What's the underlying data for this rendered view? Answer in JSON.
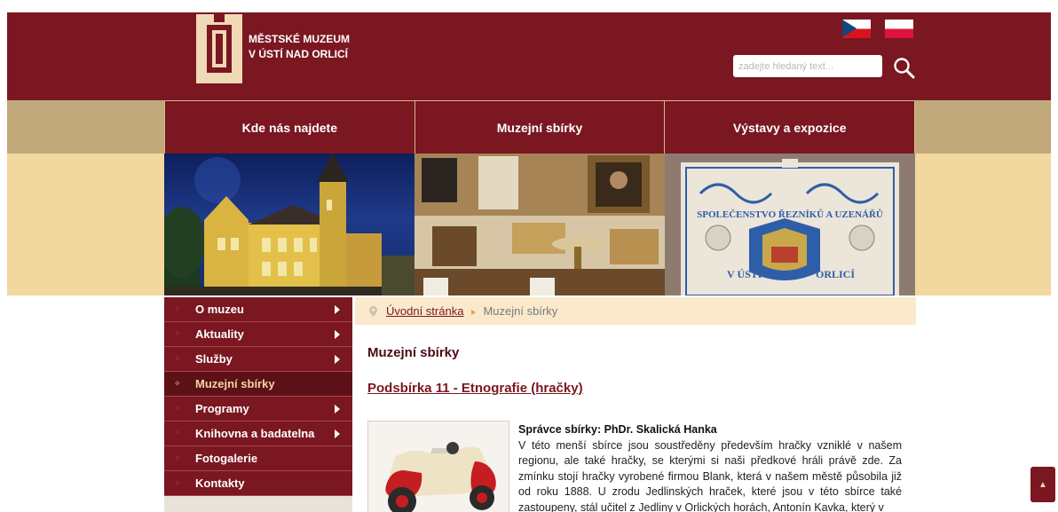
{
  "header": {
    "logo_line1": "MĚSTSKÉ MUZEUM",
    "logo_line2": "V ÚSTÍ NAD ORLICÍ",
    "languages": [
      "cz-flag-icon",
      "pl-flag-icon"
    ],
    "search": {
      "placeholder": "zadejte hledaný text...",
      "value": ""
    }
  },
  "nav": {
    "items": [
      {
        "label": "Kde nás najdete"
      },
      {
        "label": "Muzejní sbírky"
      },
      {
        "label": "Výstavy a expozice"
      }
    ]
  },
  "banner": {
    "images": [
      "museum-building-night",
      "museum-interior-salon",
      "guild-banner-embroidery"
    ],
    "flag_line1": "SPOLEČENSTVO ŘEZNÍKŮ A UZENÁŘŮ",
    "flag_line2": "V ÚSTÍ",
    "flag_line3": "ORLICÍ"
  },
  "menu": {
    "items": [
      {
        "label": "O muzeu",
        "has_submenu": true
      },
      {
        "label": "Aktuality",
        "has_submenu": true
      },
      {
        "label": "Služby",
        "has_submenu": true
      },
      {
        "label": "Muzejní sbírky",
        "has_submenu": false,
        "active": true
      },
      {
        "label": "Programy",
        "has_submenu": true
      },
      {
        "label": "Knihovna a badatelna",
        "has_submenu": true
      },
      {
        "label": "Fotogalerie",
        "has_submenu": false
      },
      {
        "label": "Kontakty",
        "has_submenu": false
      }
    ]
  },
  "breadcrumb": {
    "home": "Úvodní stránka",
    "current": "Muzejní sbírky"
  },
  "content": {
    "title": "Muzejní sbírky",
    "subtitle": "Podsbírka 11 - Etnografie (hračky)",
    "admin": "Správce sbírky: PhDr. Skalická Hanka",
    "text": "V této menší sbírce jsou soustředěny především hračky vzniklé v našem regionu, ale také hračky, se kterými si naši předkové hráli právě zde. Za zmínku stojí hračky vyrobené firmou Blank, která v našem městě působila již od roku 1888. U zrodu Jedlinských hraček, které jsou v této sbírce také zastoupeny, stál učitel z Jedliny v Orlických horách, Antonín Kavka, který v"
  },
  "colors": {
    "brand": "#7a1721",
    "brand_dark": "#5e1018",
    "gold_band": "#c2a97c",
    "cream": "#f2d79f",
    "breadcrumb_bg": "#faeacb"
  },
  "scroll_top_icon": "arrow-up-icon"
}
